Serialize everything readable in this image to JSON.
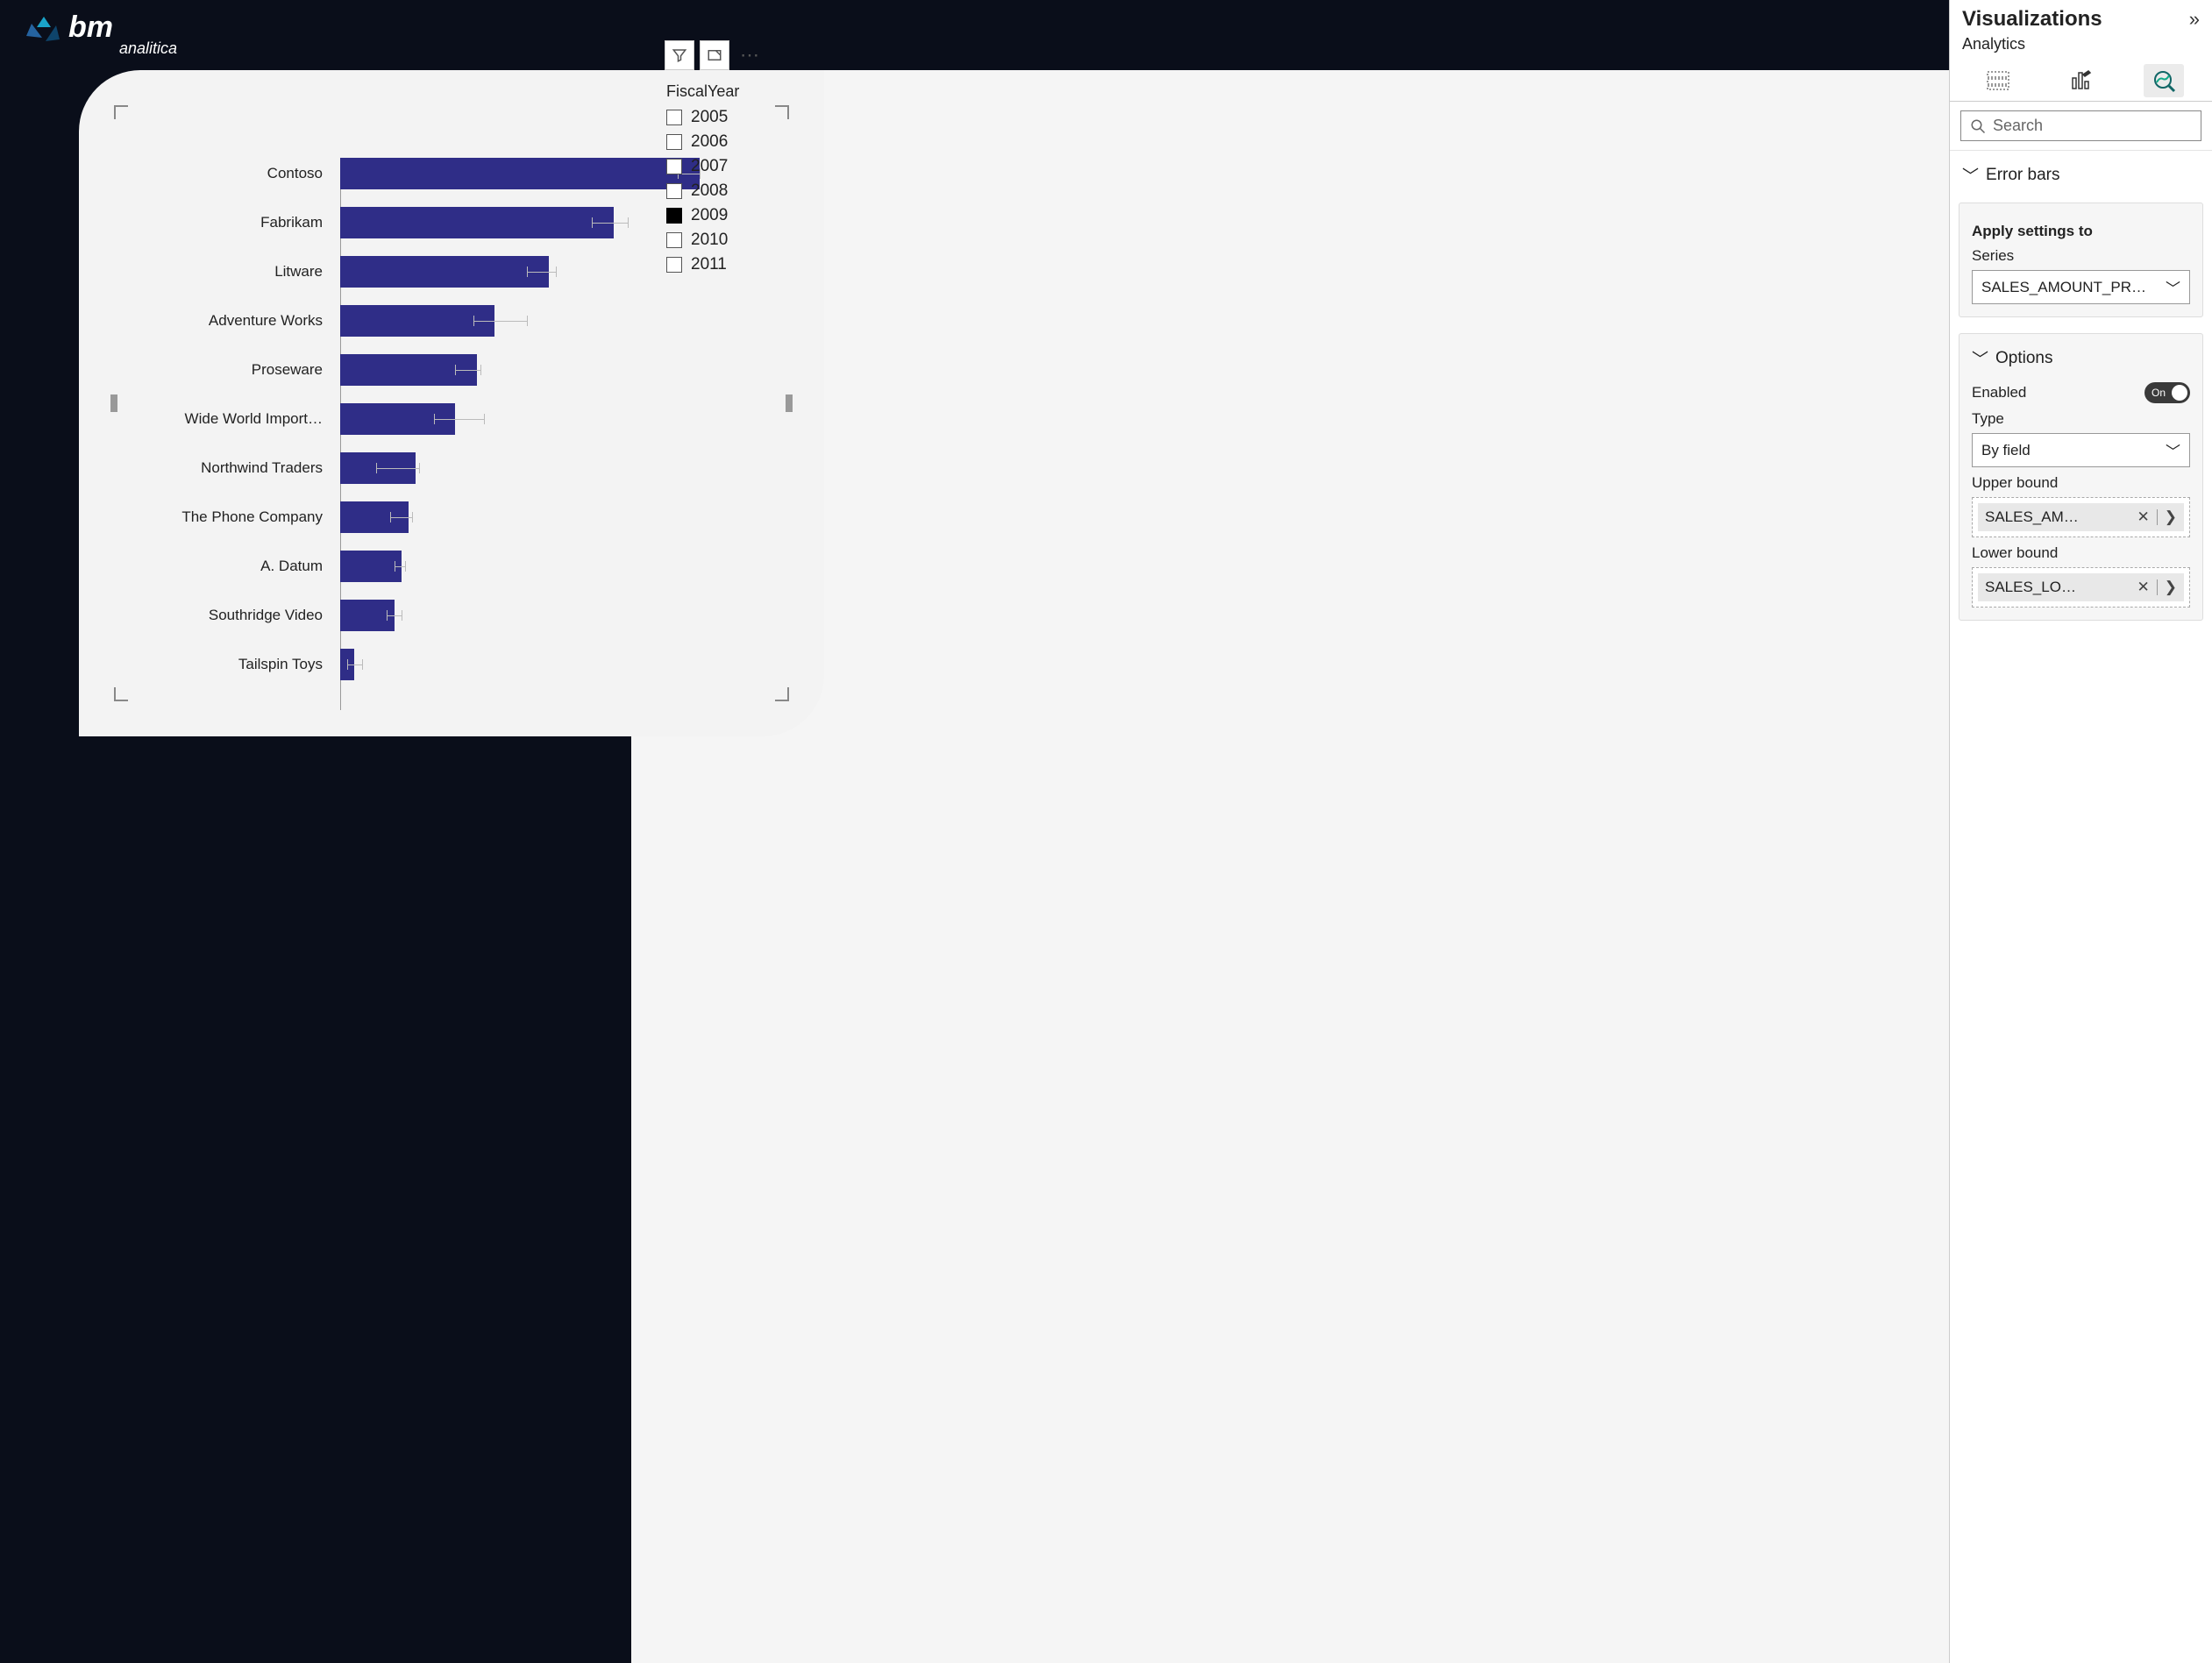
{
  "logo": {
    "brand": "bm",
    "sub": "analitica"
  },
  "toolbar": {
    "filter_tip": "Filter",
    "focus_tip": "Focus mode",
    "more_tip": "More options"
  },
  "slicer": {
    "title": "FiscalYear",
    "items": [
      {
        "label": "2005",
        "checked": false
      },
      {
        "label": "2006",
        "checked": false
      },
      {
        "label": "2007",
        "checked": false
      },
      {
        "label": "2008",
        "checked": false
      },
      {
        "label": "2009",
        "checked": true
      },
      {
        "label": "2010",
        "checked": false
      },
      {
        "label": "2011",
        "checked": false
      }
    ]
  },
  "pane": {
    "title": "Visualizations",
    "subtitle": "Analytics",
    "search_placeholder": "Search",
    "error_bars_header": "Error bars",
    "apply_header": "Apply settings to",
    "series_label": "Series",
    "series_value": "SALES_AMOUNT_PR…",
    "options_header": "Options",
    "enabled_label": "Enabled",
    "enabled_toggle": "On",
    "type_label": "Type",
    "type_value": "By field",
    "upper_label": "Upper bound",
    "upper_pill": "SALES_AM…",
    "lower_label": "Lower bound",
    "lower_pill": "SALES_LO…"
  },
  "chart_data": {
    "type": "bar",
    "title": "",
    "xlabel": "",
    "ylabel": "",
    "categories": [
      "Contoso",
      "Fabrikam",
      "Litware",
      "Adventure Works",
      "Proseware",
      "Wide World Import…",
      "Northwind Traders",
      "The Phone Company",
      "A. Datum",
      "Southridge Video",
      "Tailspin Toys"
    ],
    "values": [
      100,
      76,
      58,
      43,
      38,
      32,
      21,
      19,
      17,
      15,
      4
    ],
    "lower_bound": [
      94,
      70,
      52,
      37,
      32,
      26,
      10,
      14,
      15,
      13,
      2
    ],
    "upper_bound": [
      100,
      80,
      60,
      52,
      39,
      40,
      22,
      20,
      18,
      17,
      6
    ],
    "xlim": [
      0,
      100
    ]
  }
}
